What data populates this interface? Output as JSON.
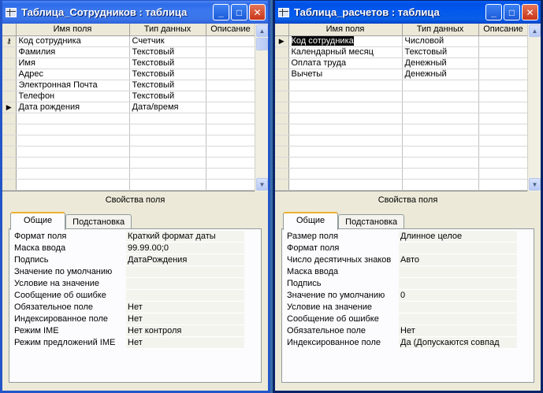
{
  "left_window": {
    "title": "Таблица_Сотрудников : таблица",
    "columns": [
      "Имя поля",
      "Тип данных",
      "Описание"
    ],
    "rows": [
      {
        "marker": "key",
        "name": "Код сотрудника",
        "type": "Счетчик",
        "desc": ""
      },
      {
        "marker": "",
        "name": "Фамилия",
        "type": "Текстовый",
        "desc": ""
      },
      {
        "marker": "",
        "name": "Имя",
        "type": "Текстовый",
        "desc": ""
      },
      {
        "marker": "",
        "name": "Адрес",
        "type": "Текстовый",
        "desc": ""
      },
      {
        "marker": "",
        "name": "Электронная Почта",
        "type": "Текстовый",
        "desc": ""
      },
      {
        "marker": "",
        "name": "Телефон",
        "type": "Текстовый",
        "desc": ""
      },
      {
        "marker": "current",
        "name": "Дата рождения",
        "type": "Дата/время",
        "desc": ""
      }
    ],
    "props_label": "Свойства поля",
    "tabs": [
      "Общие",
      "Подстановка"
    ],
    "properties": [
      {
        "name": "Формат поля",
        "value": "Краткий формат даты"
      },
      {
        "name": "Маска ввода",
        "value": "99.99.00;0"
      },
      {
        "name": "Подпись",
        "value": "ДатаРождения"
      },
      {
        "name": "Значение по умолчанию",
        "value": ""
      },
      {
        "name": "Условие на значение",
        "value": ""
      },
      {
        "name": "Сообщение об ошибке",
        "value": ""
      },
      {
        "name": "Обязательное поле",
        "value": "Нет"
      },
      {
        "name": "Индексированное поле",
        "value": "Нет"
      },
      {
        "name": "Режим IME",
        "value": "Нет контроля"
      },
      {
        "name": "Режим предложений IME",
        "value": "Нет"
      }
    ]
  },
  "right_window": {
    "title": "Таблица_расчетов : таблица",
    "columns": [
      "Имя поля",
      "Тип данных",
      "Описание"
    ],
    "rows": [
      {
        "marker": "current",
        "name": "Код сотрудника",
        "type": "Числовой",
        "desc": ""
      },
      {
        "marker": "",
        "name": "Календарный месяц",
        "type": "Текстовый",
        "desc": ""
      },
      {
        "marker": "",
        "name": "Оплата труда",
        "type": "Денежный",
        "desc": ""
      },
      {
        "marker": "",
        "name": "Вычеты",
        "type": "Денежный",
        "desc": ""
      }
    ],
    "props_label": "Свойства поля",
    "tabs": [
      "Общие",
      "Подстановка"
    ],
    "properties": [
      {
        "name": "Размер поля",
        "value": "Длинное целое"
      },
      {
        "name": "Формат поля",
        "value": ""
      },
      {
        "name": "Число десятичных знаков",
        "value": "Авто"
      },
      {
        "name": "Маска ввода",
        "value": ""
      },
      {
        "name": "Подпись",
        "value": ""
      },
      {
        "name": "Значение по умолчанию",
        "value": "0"
      },
      {
        "name": "Условие на значение",
        "value": ""
      },
      {
        "name": "Сообщение об ошибке",
        "value": ""
      },
      {
        "name": "Обязательное поле",
        "value": "Нет"
      },
      {
        "name": "Индексированное поле",
        "value": "Да (Допускаются совпад"
      }
    ]
  },
  "icons": {
    "minimize": "minimize-icon",
    "maximize": "maximize-icon",
    "close": "close-icon",
    "key": "primary-key-icon",
    "current_row": "current-row-arrow-icon"
  }
}
